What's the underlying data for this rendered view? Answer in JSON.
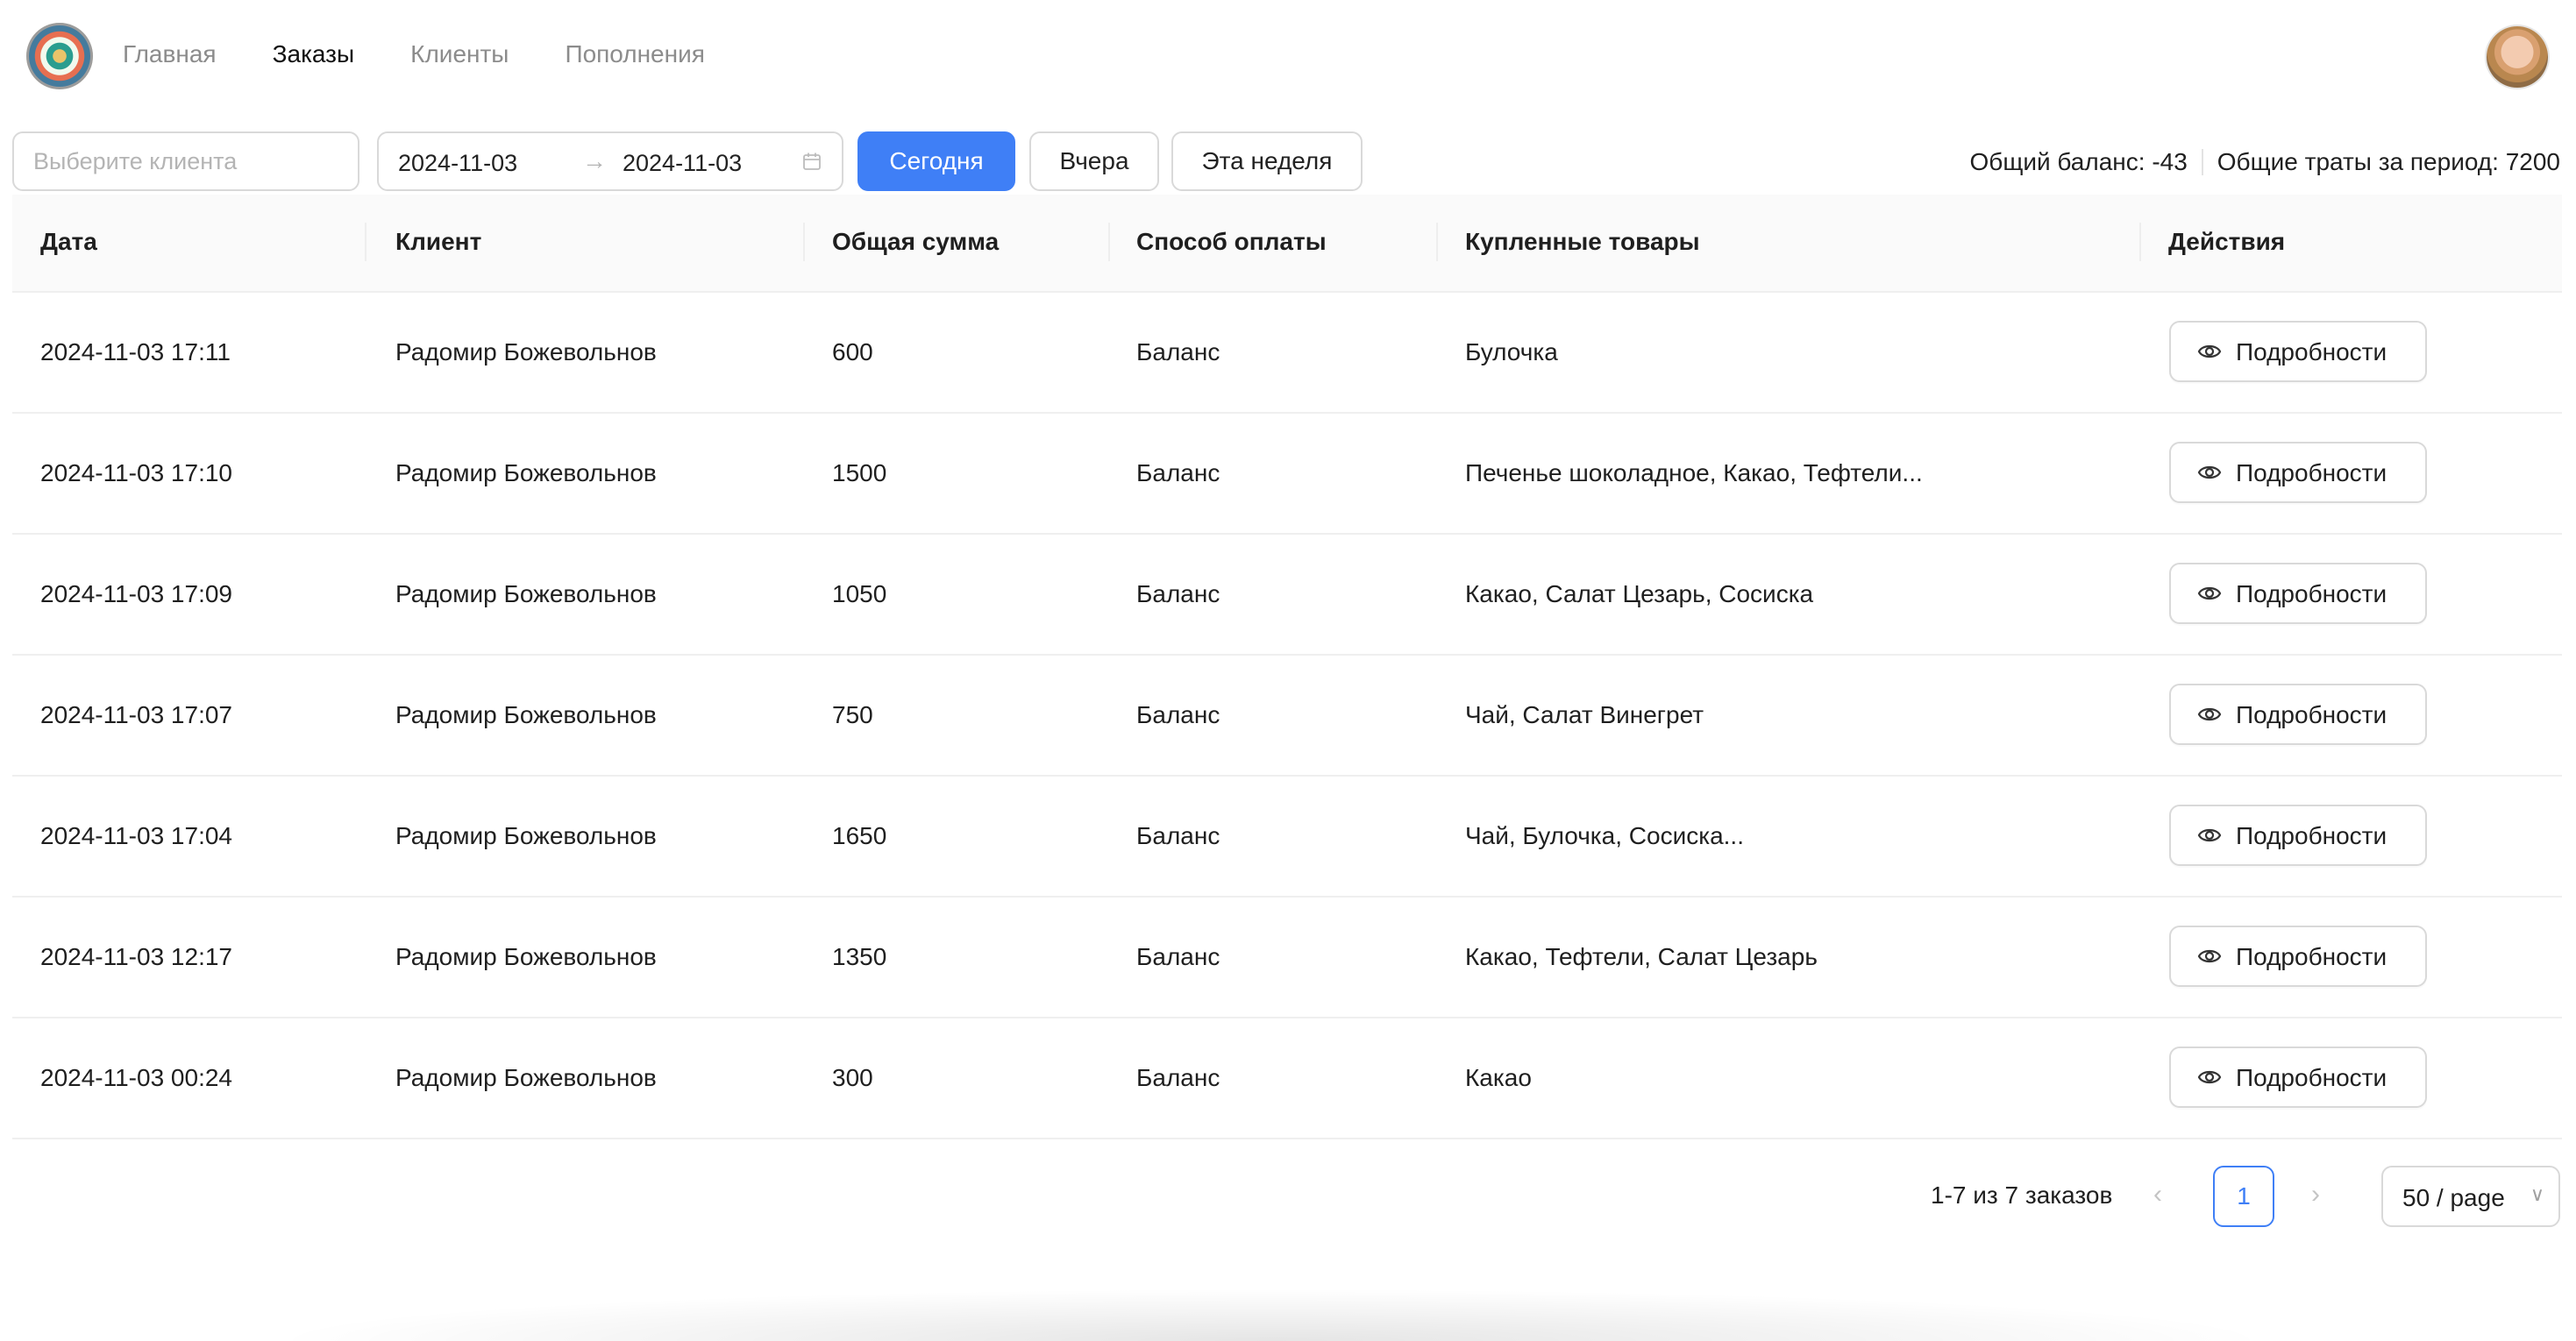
{
  "nav": {
    "items": [
      "Главная",
      "Заказы",
      "Клиенты",
      "Пополнения"
    ],
    "active_index": 1
  },
  "filters": {
    "client_placeholder": "Выберите клиента",
    "date_from": "2024-11-03",
    "date_to": "2024-11-03",
    "range_arrow": "→",
    "today_label": "Сегодня",
    "yesterday_label": "Вчера",
    "week_label": "Эта неделя"
  },
  "summary": {
    "balance": "Общий баланс: -43",
    "period_spend": "Общие траты за период: 7200"
  },
  "table": {
    "columns": [
      "Дата",
      "Клиент",
      "Общая сумма",
      "Способ оплаты",
      "Купленные товары",
      "Действия"
    ],
    "details_label": "Подробности",
    "rows": [
      {
        "date": "2024-11-03 17:11",
        "client": "Радомир Божевольнов",
        "total": "600",
        "payment": "Баланс",
        "items": "Булочка"
      },
      {
        "date": "2024-11-03 17:10",
        "client": "Радомир Божевольнов",
        "total": "1500",
        "payment": "Баланс",
        "items": "Печенье шоколадное, Какао, Тефтели..."
      },
      {
        "date": "2024-11-03 17:09",
        "client": "Радомир Божевольнов",
        "total": "1050",
        "payment": "Баланс",
        "items": "Какао, Салат Цезарь, Сосиска"
      },
      {
        "date": "2024-11-03 17:07",
        "client": "Радомир Божевольнов",
        "total": "750",
        "payment": "Баланс",
        "items": "Чай, Салат Винегрет"
      },
      {
        "date": "2024-11-03 17:04",
        "client": "Радомир Божевольнов",
        "total": "1650",
        "payment": "Баланс",
        "items": "Чай, Булочка, Сосиска..."
      },
      {
        "date": "2024-11-03 12:17",
        "client": "Радомир Божевольнов",
        "total": "1350",
        "payment": "Баланс",
        "items": "Какао, Тефтели, Салат Цезарь"
      },
      {
        "date": "2024-11-03 00:24",
        "client": "Радомир Божевольнов",
        "total": "300",
        "payment": "Баланс",
        "items": "Какао"
      }
    ]
  },
  "pagination": {
    "info": "1-7 из 7 заказов",
    "prev": "‹",
    "current_page": "1",
    "next": "›",
    "page_size": "50 / page",
    "size_chevron": "∨"
  },
  "colors": {
    "primary": "#3f7ff6",
    "border": "#d9d9d9",
    "header_bg": "#fafafa",
    "nav_inactive": "#8c8c8c"
  }
}
